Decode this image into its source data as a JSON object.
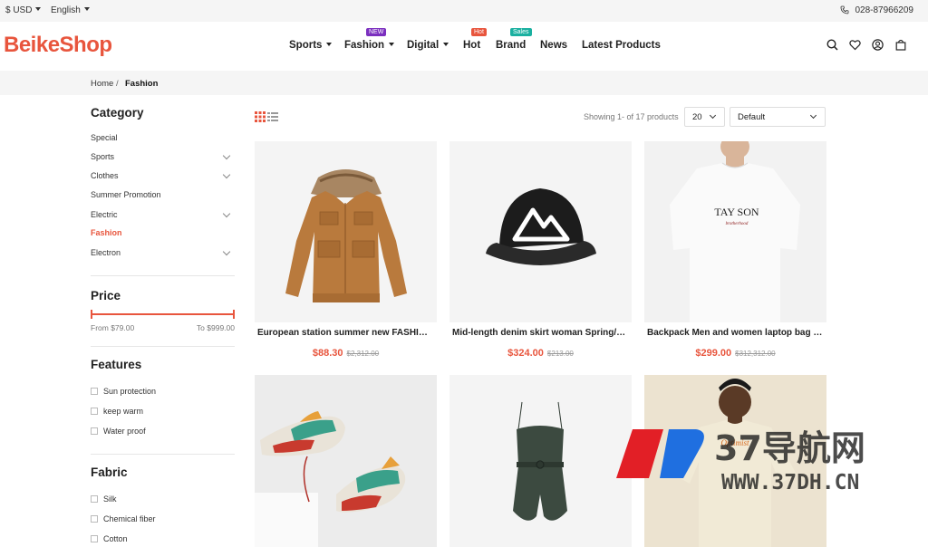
{
  "topbar": {
    "currency": "$ USD",
    "language": "English",
    "phone": "028-87966209"
  },
  "logo": "BeikeShop",
  "nav": [
    {
      "label": "Sports",
      "dropdown": true
    },
    {
      "label": "Fashion",
      "dropdown": true,
      "badge": "NEW",
      "badge_color": "#7b2fbf"
    },
    {
      "label": "Digital",
      "dropdown": true
    },
    {
      "label": "Hot",
      "dropdown": false,
      "badge": "Hot",
      "badge_color": "#e8553d"
    },
    {
      "label": "Brand",
      "dropdown": false,
      "badge": "Sales",
      "badge_color": "#1ab0a0"
    },
    {
      "label": "News",
      "dropdown": false
    },
    {
      "label": "Latest Products",
      "dropdown": false
    }
  ],
  "header_icons": [
    "search-icon",
    "heart-icon",
    "account-icon",
    "cart-icon"
  ],
  "breadcrumb": {
    "home": "Home",
    "sep": "/",
    "current": "Fashion"
  },
  "sidebar": {
    "category_title": "Category",
    "categories": [
      {
        "label": "Special",
        "expand": false,
        "active": false
      },
      {
        "label": "Sports",
        "expand": true,
        "active": false
      },
      {
        "label": "Clothes",
        "expand": true,
        "active": false
      },
      {
        "label": "Summer Promotion",
        "expand": false,
        "active": false
      },
      {
        "label": "Electric",
        "expand": true,
        "active": false
      },
      {
        "label": "Fashion",
        "expand": false,
        "active": true
      },
      {
        "label": "Electron",
        "expand": true,
        "active": false
      }
    ],
    "price_title": "Price",
    "price_from": "From $79.00",
    "price_to": "To $999.00",
    "features_title": "Features",
    "features": [
      "Sun protection",
      "keep warm",
      "Water proof"
    ],
    "fabric_title": "Fabric",
    "fabrics": [
      "Silk",
      "Chemical fiber",
      "Cotton"
    ]
  },
  "toolbar": {
    "showing": "Showing 1- of 17 products",
    "per_page": "20",
    "sort": "Default"
  },
  "products": [
    {
      "name": "European station summer new FASHION pr",
      "price": "$88.30",
      "old_price": "$2,312.00",
      "image": "jacket"
    },
    {
      "name": "Mid-length denim skirt woman Spring/Summer",
      "price": "$324.00",
      "old_price": "$213.00",
      "image": "cap"
    },
    {
      "name": "Backpack Men and women laptop bag Large",
      "price": "$299.00",
      "old_price": "$312,312.00",
      "image": "tshirt",
      "shirt_text": "TAY SON",
      "shirt_sub": "brotherhood"
    },
    {
      "name": "",
      "price": "",
      "old_price": "",
      "image": "sneakers"
    },
    {
      "name": "",
      "price": "",
      "old_price": "",
      "image": "romper"
    },
    {
      "name": "",
      "price": "",
      "old_price": "",
      "image": "model"
    }
  ],
  "watermark": {
    "text": "37导航网",
    "url": "WWW.37DH.CN"
  },
  "colors": {
    "accent": "#e8553d",
    "badge_new": "#7b2fbf",
    "badge_sales": "#1ab0a0"
  }
}
